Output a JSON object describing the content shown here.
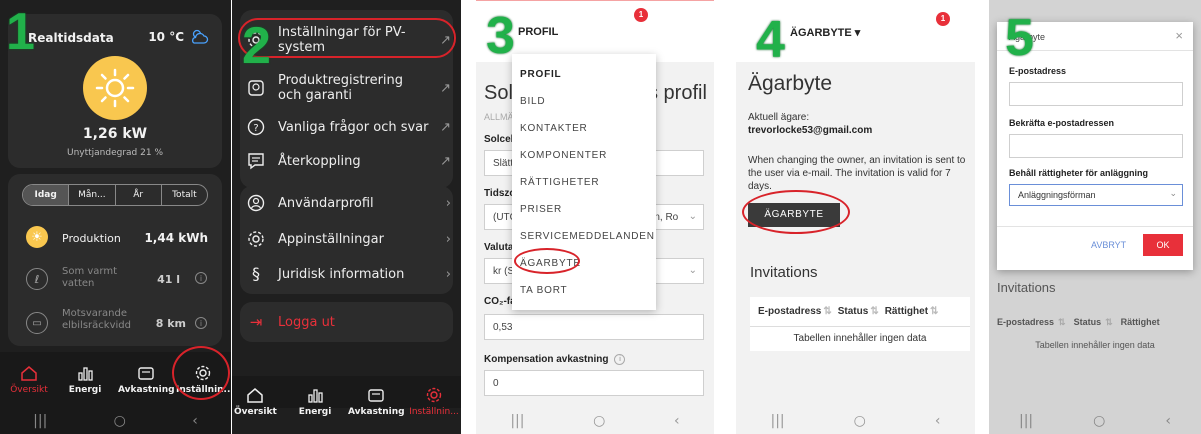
{
  "steps": [
    "1",
    "2",
    "3",
    "4",
    "5"
  ],
  "panel1": {
    "title": "Realtidsdata",
    "temperature": "10 °C",
    "power": "1,26 kW",
    "self_consumption": "Unyttjandegrad 21 %",
    "period_tabs": [
      "Idag",
      "Mån...",
      "År",
      "Totalt"
    ],
    "rows": [
      {
        "label": "Produktion",
        "value": "1,44 kWh"
      },
      {
        "label": "Som varmt vatten",
        "value": "41 l"
      },
      {
        "label": "Motsvarande elbilsräckvidd",
        "value": "8 km"
      }
    ],
    "nav": [
      "Översikt",
      "Energi",
      "Avkastning",
      "Inställnin..."
    ]
  },
  "panel2": {
    "menu": [
      {
        "label": "Inställningar för PV-system"
      },
      {
        "label": "Produktregistrering och garanti"
      },
      {
        "label": "Vanliga frågor och svar"
      },
      {
        "label": "Återkoppling"
      },
      {
        "label": "Användarprofil"
      },
      {
        "label": "Appinställningar"
      },
      {
        "label": "Juridisk information"
      }
    ],
    "logout": "Logga ut",
    "nav": [
      "Översikt",
      "Energi",
      "Avkastning",
      "Inställnin..."
    ]
  },
  "panel3": {
    "tab": "PROFIL",
    "badge": "1",
    "heading_start": "Solc",
    "heading_end": "s profil",
    "section_fragment": "ALLMÄ",
    "fields": [
      {
        "label": "Solcell",
        "value": "Slätt"
      },
      {
        "label": "Tidszo",
        "value": "(UTC",
        "suffix": "rn, Ro"
      },
      {
        "label": "Valuta",
        "value": "kr (S"
      },
      {
        "label": "CO₂-fa",
        "value": "0,53"
      },
      {
        "label": "Kompensation avkastning",
        "value": "0"
      }
    ],
    "dropdown": [
      "PROFIL",
      "BILD",
      "KONTAKTER",
      "KOMPONENTER",
      "RÄTTIGHETER",
      "PRISER",
      "SERVICEMEDDELANDEN",
      "ÄGARBYTE",
      "TA BORT"
    ]
  },
  "panel4": {
    "tab": "ÄGARBYTE",
    "badge": "1",
    "title": "Ägarbyte",
    "current_owner_label": "Aktuell ägare:",
    "current_owner_email": "trevorlocke53@gmail.com",
    "info": "When changing the owner, an invitation is sent to the user via e-mail. The invitation is valid for 7 days.",
    "button": "ÄGARBYTE",
    "invitations_title": "Invitations",
    "table_headers": [
      "E-postadress",
      "Status",
      "Rättighet"
    ],
    "empty_text": "Tabellen innehåller ingen data"
  },
  "panel5": {
    "dialog_title": "Ägarbyte",
    "close": "×",
    "email_label": "E-postadress",
    "confirm_label": "Bekräfta e-postadressen",
    "rights_label": "Behåll rättigheter för anläggning",
    "rights_value": "Anläggningsförman",
    "cancel": "AVBRYT",
    "ok": "OK",
    "invitations_title": "Invitations",
    "table_headers": [
      "E-postadress",
      "Status",
      "Rättighet"
    ],
    "empty_text": "Tabellen innehåller ingen data"
  },
  "colors": {
    "accent": "#e8303a",
    "sun": "#f9c74f",
    "step_green": "#21b14a",
    "annotation_red": "#d8232a"
  }
}
